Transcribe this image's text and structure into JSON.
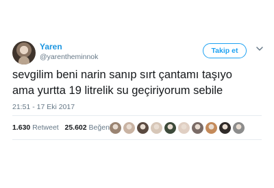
{
  "profile": {
    "display_name": "Yaren",
    "handle": "@yarentheminnok",
    "follow_label": "Takip et",
    "menu_icon": "chevron-down-icon"
  },
  "tweet": {
    "lines": [
      "sevgilim beni narin sanıp sırt çantamı taşıyo",
      "ama yurtta 19 litrelik su geçiriyorum sebile"
    ],
    "timestamp": "21:51 - 17 Eki 2017"
  },
  "stats": {
    "retweets_count": "1.630",
    "retweets_label": "Retweet",
    "likes_count": "25.602",
    "likes_label": "Beğeni"
  },
  "likers": [
    "#9a8472",
    "#c9b3a3",
    "#5a4a40",
    "#d7c7b8",
    "#3d4a3a",
    "#e0cfc3",
    "#7a6b66",
    "#c48a5a",
    "#2f2a28",
    "#8c8c8c"
  ],
  "colors": {
    "accent": "#1da1f2",
    "link": "#1b95e0",
    "muted": "#657786",
    "text": "#14171a"
  }
}
